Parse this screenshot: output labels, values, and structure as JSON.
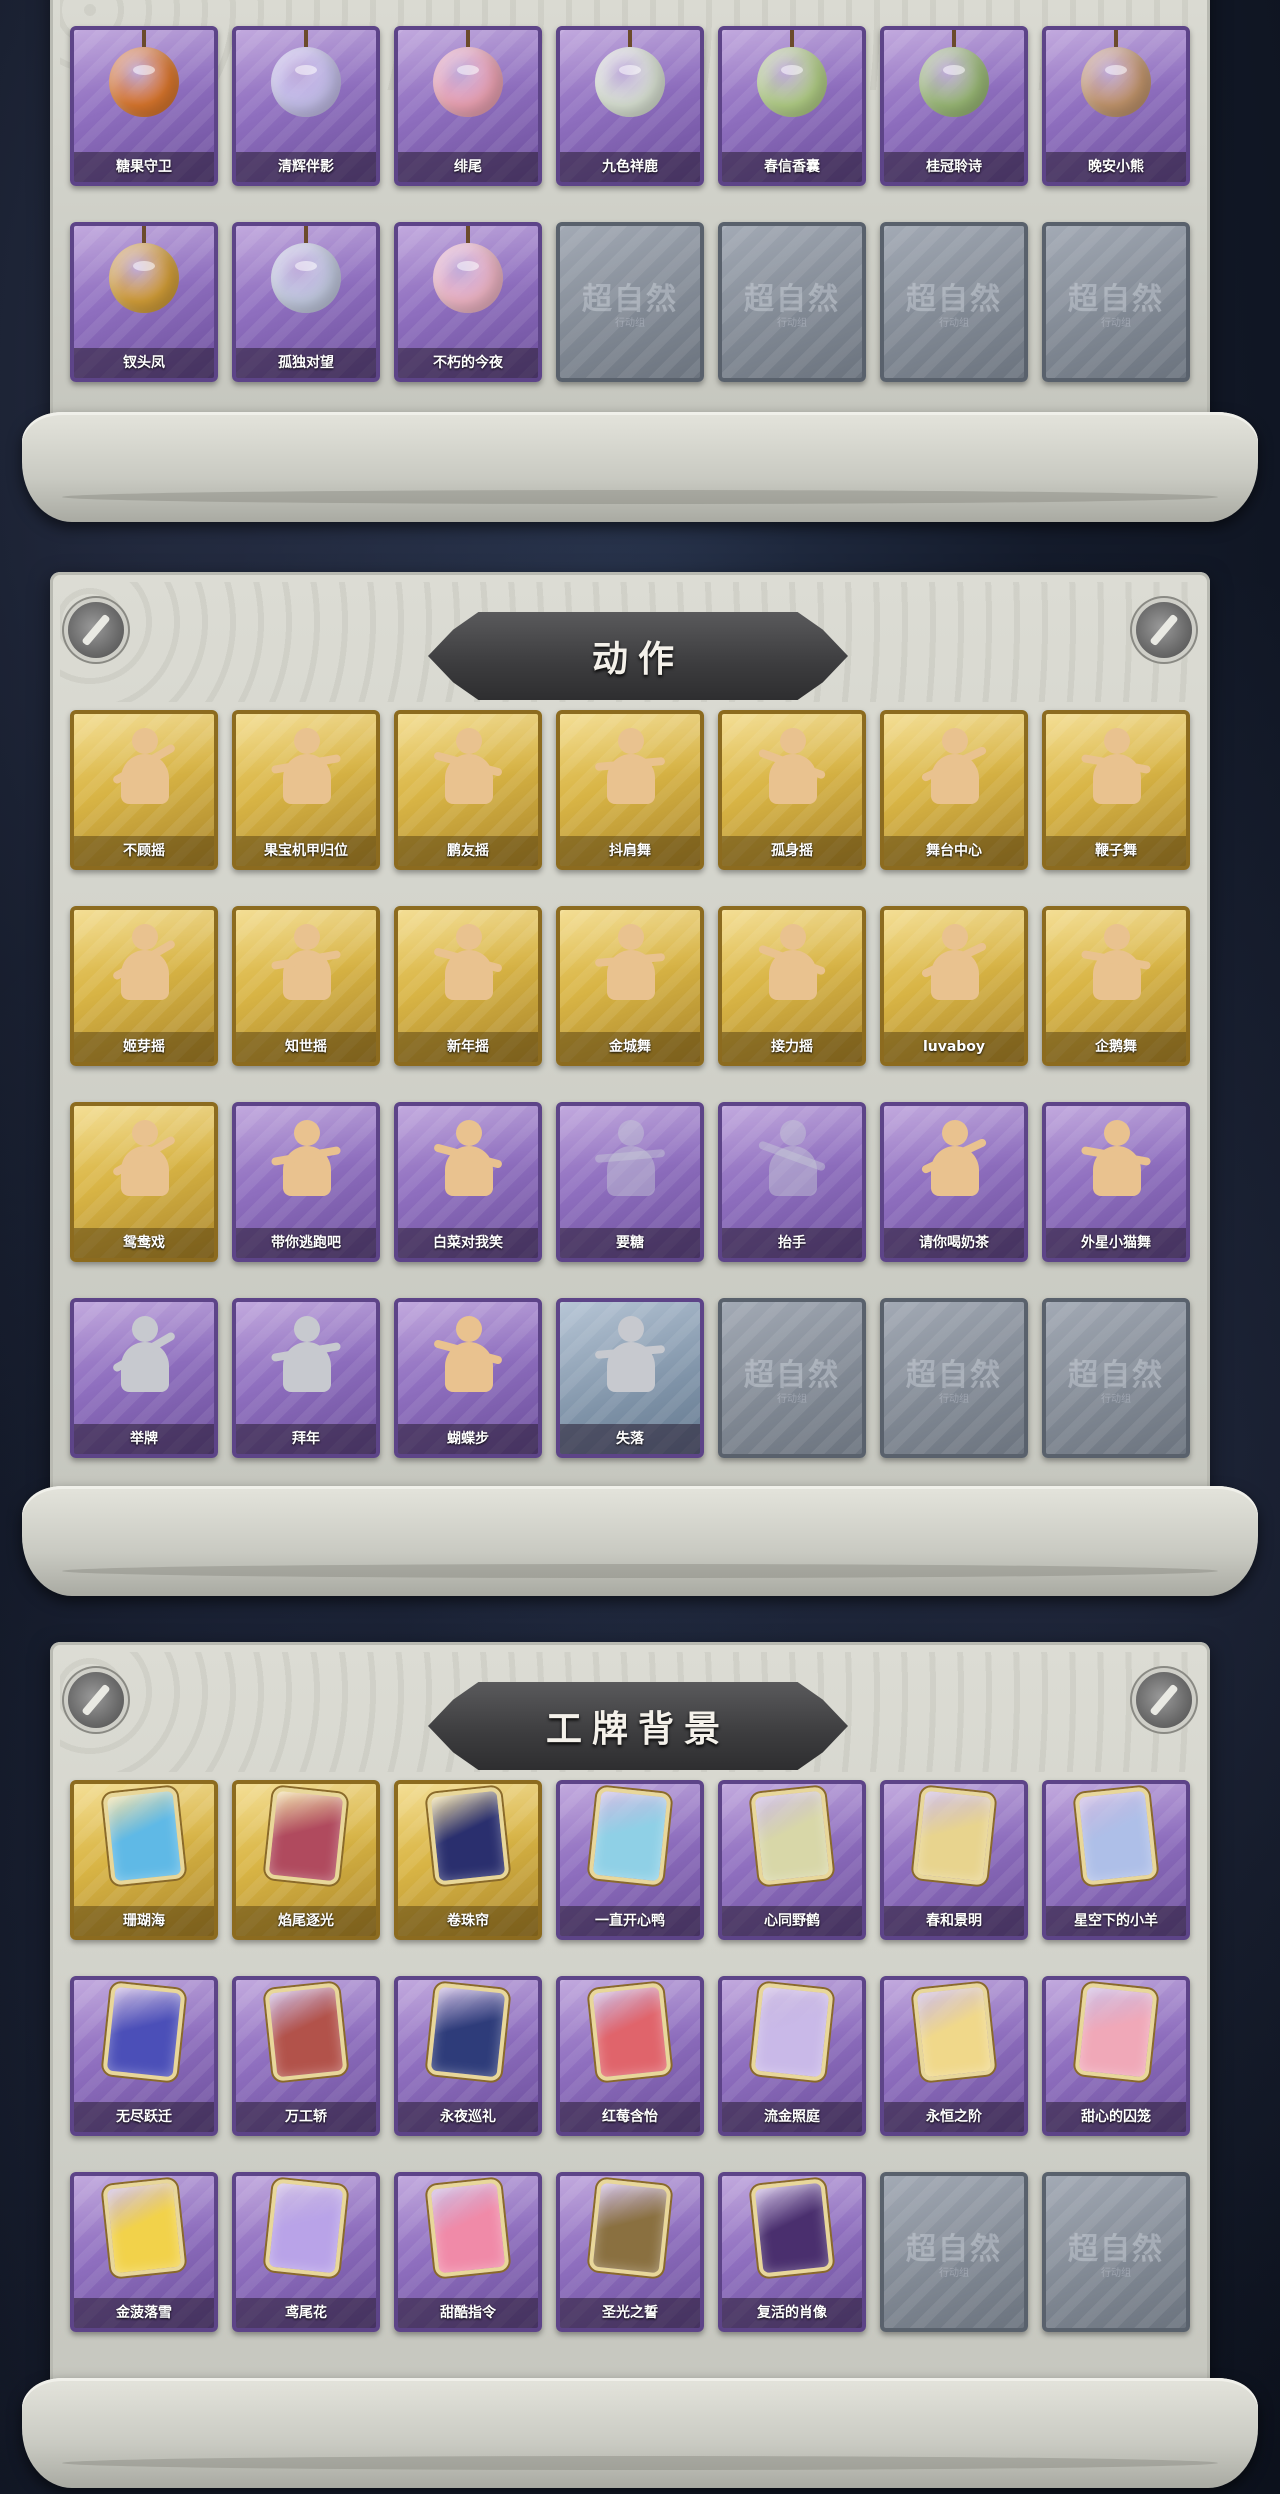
{
  "colors": {
    "panel": "#d4d5cd",
    "purple_card": "#8f6fbf",
    "gold_card": "#d8b445",
    "empty_card": "#7f8792",
    "title_plate": "#3c3c3e"
  },
  "empty_slot": {
    "mark": "超自然",
    "sub": "行动组"
  },
  "pendants": {
    "items": [
      {
        "label": "糖果守卫",
        "color": "#e07a2e"
      },
      {
        "label": "清辉伴影",
        "color": "#c9c4f0"
      },
      {
        "label": "绯尾",
        "color": "#f2a7b8"
      },
      {
        "label": "九色祥鹿",
        "color": "#dfe8d9"
      },
      {
        "label": "春信香囊",
        "color": "#b7d48a"
      },
      {
        "label": "桂冠聆诗",
        "color": "#9fbf7a"
      },
      {
        "label": "晚安小熊",
        "color": "#c89a70"
      },
      {
        "label": "钗头凤",
        "color": "#d9a33a"
      },
      {
        "label": "孤独对望",
        "color": "#c7cfe6"
      },
      {
        "label": "不朽的今夜",
        "color": "#f4b9c9"
      }
    ],
    "empty_count": 4
  },
  "actions": {
    "title": "动作",
    "items": [
      {
        "label": "不顾摇",
        "tier": "gold"
      },
      {
        "label": "果宝机甲归位",
        "tier": "gold"
      },
      {
        "label": "鹏友摇",
        "tier": "gold"
      },
      {
        "label": "抖肩舞",
        "tier": "gold"
      },
      {
        "label": "孤身摇",
        "tier": "gold"
      },
      {
        "label": "舞台中心",
        "tier": "gold"
      },
      {
        "label": "鞭子舞",
        "tier": "gold"
      },
      {
        "label": "姬芽摇",
        "tier": "gold"
      },
      {
        "label": "知世摇",
        "tier": "gold"
      },
      {
        "label": "新年摇",
        "tier": "gold"
      },
      {
        "label": "金城舞",
        "tier": "gold"
      },
      {
        "label": "接力摇",
        "tier": "gold"
      },
      {
        "label": "luvaboy",
        "tier": "gold"
      },
      {
        "label": "企鹅舞",
        "tier": "gold"
      },
      {
        "label": "鸳鸯戏",
        "tier": "gold"
      },
      {
        "label": "带你逃跑吧",
        "tier": "purple"
      },
      {
        "label": "白菜对我笑",
        "tier": "purple"
      },
      {
        "label": "要糖",
        "tier": "purple-dim"
      },
      {
        "label": "抬手",
        "tier": "purple-dim"
      },
      {
        "label": "请你喝奶茶",
        "tier": "purple"
      },
      {
        "label": "外星小猫舞",
        "tier": "purple"
      },
      {
        "label": "举牌",
        "tier": "purple-gray"
      },
      {
        "label": "拜年",
        "tier": "purple-gray"
      },
      {
        "label": "蝴蝶步",
        "tier": "purple"
      },
      {
        "label": "失落",
        "tier": "blue"
      }
    ],
    "empty_count": 3
  },
  "badges": {
    "title": "工牌背景",
    "items": [
      {
        "label": "珊瑚海",
        "tier": "gold",
        "color": "#5fb9e6"
      },
      {
        "label": "焰尾逐光",
        "tier": "gold",
        "color": "#b04a5e"
      },
      {
        "label": "卷珠帘",
        "tier": "gold",
        "color": "#2a2f6e"
      },
      {
        "label": "一直开心鸭",
        "tier": "purple",
        "color": "#8fd0e6"
      },
      {
        "label": "心同野鹤",
        "tier": "purple",
        "color": "#d8d7a8"
      },
      {
        "label": "春和景明",
        "tier": "purple",
        "color": "#e8d48e"
      },
      {
        "label": "星空下的小羊",
        "tier": "purple",
        "color": "#aebfe8"
      },
      {
        "label": "无尽跃迁",
        "tier": "purple",
        "color": "#4b4fb8"
      },
      {
        "label": "万工轿",
        "tier": "purple",
        "color": "#b2524a"
      },
      {
        "label": "永夜巡礼",
        "tier": "purple",
        "color": "#2e3c7a"
      },
      {
        "label": "红莓含怡",
        "tier": "purple",
        "color": "#e0646b"
      },
      {
        "label": "流金照庭",
        "tier": "purple",
        "color": "#c9b9e8"
      },
      {
        "label": "永恒之阶",
        "tier": "purple",
        "color": "#f0d88a"
      },
      {
        "label": "甜心的囚笼",
        "tier": "purple",
        "color": "#f0a8b8"
      },
      {
        "label": "金菠落雪",
        "tier": "purple",
        "color": "#f2d24a"
      },
      {
        "label": "鸢尾花",
        "tier": "purple",
        "color": "#b9a3e8"
      },
      {
        "label": "甜酷指令",
        "tier": "purple",
        "color": "#f08aa8"
      },
      {
        "label": "圣光之誓",
        "tier": "purple",
        "color": "#8a7040"
      },
      {
        "label": "复活的肖像",
        "tier": "purple",
        "color": "#4a2f6e"
      }
    ],
    "empty_count": 2
  }
}
